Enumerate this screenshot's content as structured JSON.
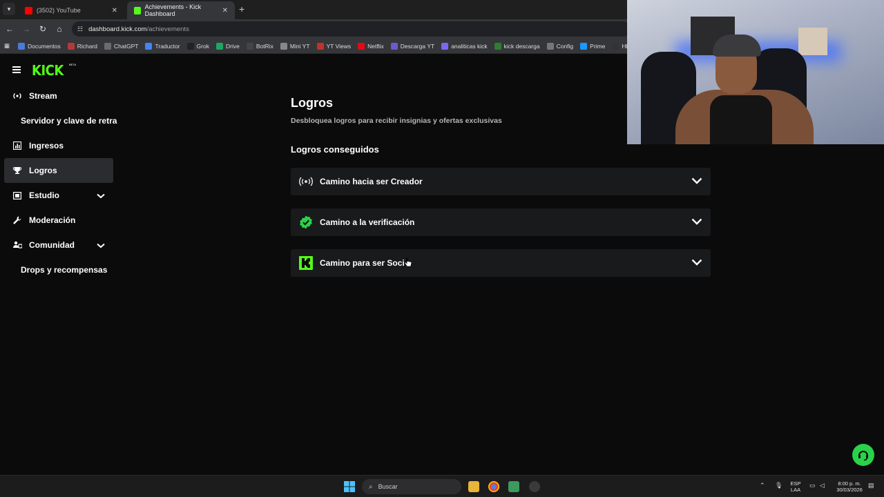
{
  "browser": {
    "tabs": [
      {
        "title": "(3502) YouTube",
        "favicon_color": "#ff0000"
      },
      {
        "title": "Achievements - Kick Dashboard",
        "favicon_color": "#53fc18"
      }
    ],
    "url_host": "dashboard.kick.com",
    "url_path": "/achievements",
    "bookmarks": [
      {
        "label": "Documentos",
        "color": "#4a7bd9"
      },
      {
        "label": "Richard",
        "color": "#b23a3a"
      },
      {
        "label": "ChatGPT",
        "color": "#6b6b6b"
      },
      {
        "label": "Traductor",
        "color": "#4285f4"
      },
      {
        "label": "Grok",
        "color": "#222222"
      },
      {
        "label": "Drive",
        "color": "#1fa463"
      },
      {
        "label": "BotRix",
        "color": "#444444"
      },
      {
        "label": "Mini YT",
        "color": "#888888"
      },
      {
        "label": "YT Views",
        "color": "#c4302b"
      },
      {
        "label": "Netflix",
        "color": "#e50914"
      },
      {
        "label": "Descarga YT",
        "color": "#6a5acd"
      },
      {
        "label": "analiticas kick",
        "color": "#7b68ee"
      },
      {
        "label": "kick descarga",
        "color": "#2e7d32"
      },
      {
        "label": "Config",
        "color": "#777777"
      },
      {
        "label": "Prime",
        "color": "#1a98ff"
      },
      {
        "label": "HE",
        "color": "#333333"
      }
    ]
  },
  "kick": {
    "logo": "KICK",
    "beta": "BETA"
  },
  "sidebar": {
    "items": [
      {
        "label": "Stream"
      },
      {
        "label": "Servidor y clave de retra"
      },
      {
        "label": "Ingresos"
      },
      {
        "label": "Logros"
      },
      {
        "label": "Estudio"
      },
      {
        "label": "Moderación"
      },
      {
        "label": "Comunidad"
      },
      {
        "label": "Drops y recompensas"
      }
    ]
  },
  "main": {
    "title": "Logros",
    "subtitle": "Desbloquea logros para recibir insignias y ofertas exclusivas",
    "section_title": "Logros conseguidos",
    "accordions": [
      {
        "label": "Camino hacia ser Creador"
      },
      {
        "label": "Camino a la verificación"
      },
      {
        "label": "Camino para ser Soci"
      }
    ]
  },
  "taskbar": {
    "search_placeholder": "Buscar",
    "lang_top": "ESP",
    "lang_bottom": "LAA",
    "time": "8:00 p. m.",
    "date": "30/03/2026"
  },
  "colors": {
    "kick_green": "#53fc18",
    "verified_green": "#2ad24a"
  }
}
